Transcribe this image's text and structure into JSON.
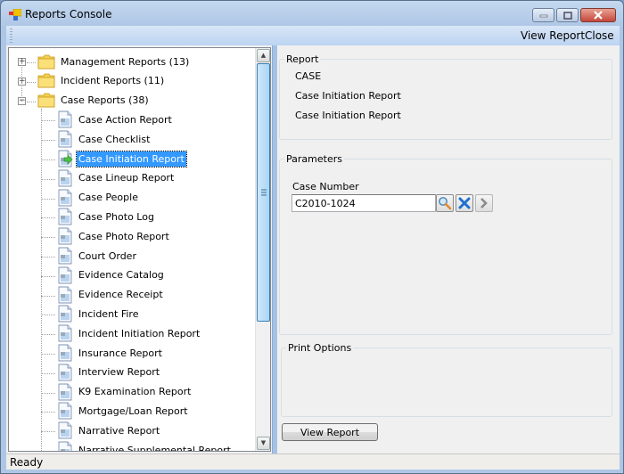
{
  "window": {
    "title": "Reports Console",
    "caption_buttons": [
      "minimize",
      "maximize",
      "close"
    ]
  },
  "menubar": {
    "items": [
      {
        "label": "View Report"
      },
      {
        "label": "Close"
      }
    ]
  },
  "tree": {
    "folders": [
      {
        "label": "Management Reports (13)",
        "expanded": false
      },
      {
        "label": "Incident Reports (11)",
        "expanded": false
      },
      {
        "label": "Case Reports (38)",
        "expanded": true
      }
    ],
    "case_reports": [
      {
        "label": "Case Action Report"
      },
      {
        "label": "Case Checklist"
      },
      {
        "label": "Case Initiation Report",
        "selected": true
      },
      {
        "label": "Case Lineup Report"
      },
      {
        "label": "Case People"
      },
      {
        "label": "Case Photo Log"
      },
      {
        "label": "Case Photo Report"
      },
      {
        "label": "Court Order"
      },
      {
        "label": "Evidence Catalog"
      },
      {
        "label": "Evidence Receipt"
      },
      {
        "label": "Incident Fire"
      },
      {
        "label": "Incident Initiation Report"
      },
      {
        "label": "Insurance Report"
      },
      {
        "label": "Interview Report"
      },
      {
        "label": "K9 Examination Report"
      },
      {
        "label": "Mortgage/Loan Report"
      },
      {
        "label": "Narrative Report"
      },
      {
        "label": "Narrative Supplemental Report"
      }
    ]
  },
  "report_group": {
    "legend": "Report",
    "lines": [
      "CASE",
      "Case Initiation Report",
      "Case Initiation Report"
    ]
  },
  "parameters_group": {
    "legend": "Parameters",
    "case_number_label": "Case Number",
    "case_number_value": "C2010-1024"
  },
  "print_options_group": {
    "legend": "Print Options"
  },
  "view_report_button": "View Report",
  "status": {
    "text": "Ready"
  },
  "colors": {
    "selection": "#3399ff",
    "titlebar": "#c4d8ef",
    "menubar": "#bcd4f2"
  }
}
